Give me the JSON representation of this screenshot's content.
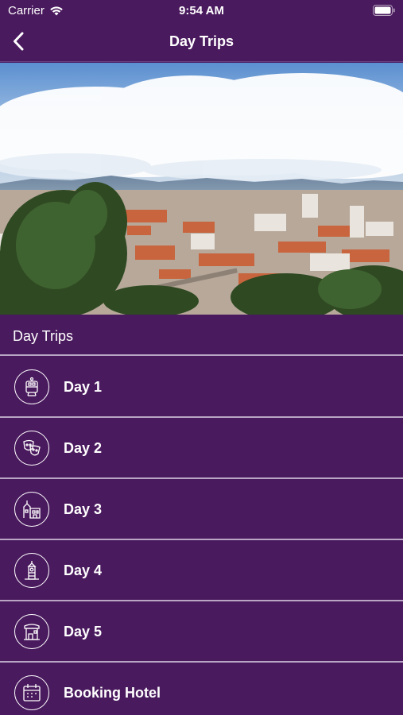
{
  "status_bar": {
    "carrier": "Carrier",
    "time": "9:54 AM"
  },
  "nav": {
    "title": "Day Trips"
  },
  "section": {
    "title": "Day Trips"
  },
  "items": [
    {
      "label": "Day 1",
      "icon": "tram-icon"
    },
    {
      "label": "Day 2",
      "icon": "theatre-masks-icon"
    },
    {
      "label": "Day 3",
      "icon": "castle-icon"
    },
    {
      "label": "Day 4",
      "icon": "tower-icon"
    },
    {
      "label": "Day 5",
      "icon": "shop-icon"
    },
    {
      "label": "Booking Hotel",
      "icon": "calendar-icon"
    }
  ],
  "colors": {
    "primary": "#4a1a5e",
    "divider": "#b9a6c4",
    "text": "#ffffff"
  }
}
